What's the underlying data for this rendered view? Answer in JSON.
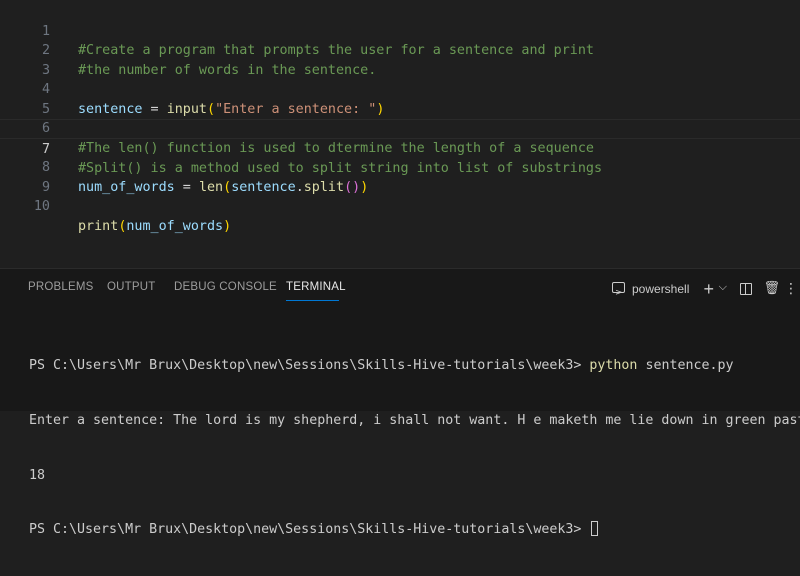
{
  "editor": {
    "lines": [
      {
        "n": "1",
        "comment": "#Create a program that prompts the user for a sentence and print"
      },
      {
        "n": "2",
        "comment": "#the number of words in the sentence."
      },
      {
        "n": "3"
      },
      {
        "n": "4",
        "var": "sentence",
        "op": " = ",
        "fn": "input",
        "open": "(",
        "str": "\"Enter a sentence: \"",
        "close": ")"
      },
      {
        "n": "5"
      },
      {
        "n": "6",
        "comment": "#The len() function is used to dtermine the length of a sequence"
      },
      {
        "n": "7",
        "comment": "#Split() is a method used to split string into list of substrings"
      },
      {
        "n": "8",
        "var": "num_of_words",
        "op": " = ",
        "fn": "len",
        "open": "(",
        "arg": "sentence",
        "dot": ".",
        "method": "split",
        "inner": "()",
        "close": ")"
      },
      {
        "n": "9"
      },
      {
        "n": "10",
        "fn": "print",
        "open": "(",
        "arg": "num_of_words",
        "close": ")"
      }
    ],
    "current_line": "7"
  },
  "panel": {
    "tabs": [
      "PROBLEMS",
      "OUTPUT",
      "DEBUG CONSOLE",
      "TERMINAL"
    ],
    "active_tab": "TERMINAL",
    "shell_label": "powershell",
    "add_glyph": "+",
    "chevron_glyph": "⌵",
    "trash_glyph": "🗑",
    "more_glyph": "⋮"
  },
  "terminal": {
    "prompt1": "PS C:\\Users\\Mr Brux\\Desktop\\new\\Sessions\\Skills-Hive-tutorials\\week3> ",
    "cmd": "python",
    "cmd_args": " sentence.py",
    "output1": "Enter a sentence: The lord is my shepherd, i shall not want. H e maketh me lie down in green pastures",
    "output2": "18",
    "prompt2": "PS C:\\Users\\Mr Brux\\Desktop\\new\\Sessions\\Skills-Hive-tutorials\\week3> "
  },
  "colors": {
    "editor_bg": "#1f1f1f",
    "panel_bg": "#181818",
    "comment": "#6a9955",
    "function": "#dcdcaa",
    "variable": "#9cdcfe",
    "string": "#ce9178",
    "accent": "#0078d4"
  }
}
